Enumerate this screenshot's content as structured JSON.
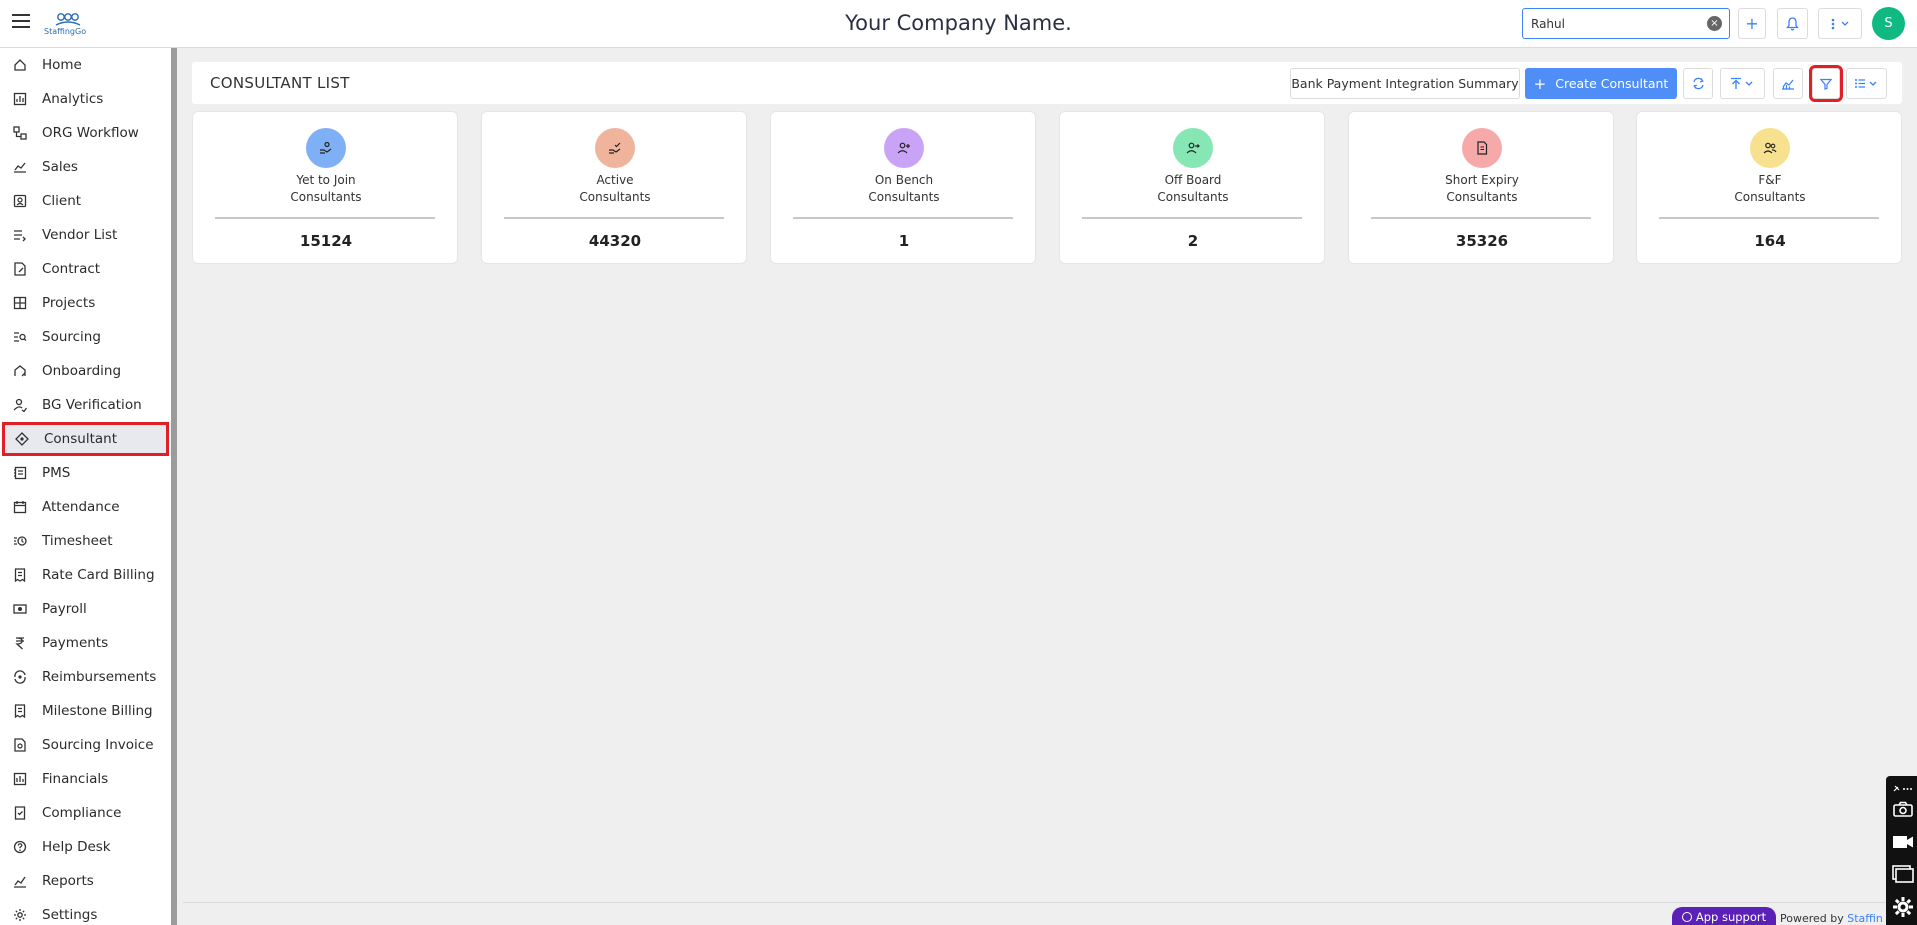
{
  "topbar": {
    "logo_text": "StaffingGo",
    "company_name": "Your Company Name.",
    "search_value": "Rahul",
    "clear_symbol": "×",
    "add_symbol": "+",
    "avatar_initial": "S"
  },
  "sidebar": {
    "items": [
      {
        "label": "Home",
        "icon": "home-icon"
      },
      {
        "label": "Analytics",
        "icon": "analytics-icon"
      },
      {
        "label": "ORG Workflow",
        "icon": "workflow-icon"
      },
      {
        "label": "Sales",
        "icon": "sales-icon"
      },
      {
        "label": "Client",
        "icon": "client-icon"
      },
      {
        "label": "Vendor List",
        "icon": "vendor-icon"
      },
      {
        "label": "Contract",
        "icon": "contract-icon"
      },
      {
        "label": "Projects",
        "icon": "projects-icon"
      },
      {
        "label": "Sourcing",
        "icon": "sourcing-icon"
      },
      {
        "label": "Onboarding",
        "icon": "onboarding-icon"
      },
      {
        "label": "BG Verification",
        "icon": "verification-icon"
      },
      {
        "label": "Consultant",
        "icon": "consultant-icon",
        "active": true
      },
      {
        "label": "PMS",
        "icon": "pms-icon"
      },
      {
        "label": "Attendance",
        "icon": "calendar-icon"
      },
      {
        "label": "Timesheet",
        "icon": "timesheet-icon"
      },
      {
        "label": "Rate Card Billing",
        "icon": "billing-icon"
      },
      {
        "label": "Payroll",
        "icon": "payroll-icon"
      },
      {
        "label": "Payments",
        "icon": "rupee-icon"
      },
      {
        "label": "Reimbursements",
        "icon": "reimbursement-icon"
      },
      {
        "label": "Milestone Billing",
        "icon": "milestone-icon"
      },
      {
        "label": "Sourcing Invoice",
        "icon": "invoice-icon"
      },
      {
        "label": "Financials",
        "icon": "financials-icon"
      },
      {
        "label": "Compliance",
        "icon": "compliance-icon"
      },
      {
        "label": "Help Desk",
        "icon": "help-icon"
      },
      {
        "label": "Reports",
        "icon": "reports-icon"
      },
      {
        "label": "Settings",
        "icon": "settings-icon"
      }
    ]
  },
  "header": {
    "title": "CONSULTANT LIST",
    "bank_summary_label": "Bank Payment Integration Summary",
    "create_label": "Create Consultant",
    "create_symbol": "+"
  },
  "cards": [
    {
      "line1": "Yet to Join",
      "line2": "Consultants",
      "count": "15124",
      "color": "#7fb0f5",
      "icon": "user-hand-icon"
    },
    {
      "line1": "Active",
      "line2": "Consultants",
      "count": "44320",
      "color": "#f0b49c",
      "icon": "user-check-icon"
    },
    {
      "line1": "On Bench",
      "line2": "Consultants",
      "count": "1",
      "color": "#c9a3f5",
      "icon": "user-plus-icon"
    },
    {
      "line1": "Off Board",
      "line2": "Consultants",
      "count": "2",
      "color": "#86e6b4",
      "icon": "user-out-icon"
    },
    {
      "line1": "Short Expiry",
      "line2": "Consultants",
      "count": "35326",
      "color": "#f7a9a9",
      "icon": "document-icon"
    },
    {
      "line1": "F&F",
      "line2": "Consultants",
      "count": "164",
      "color": "#f7e08e",
      "icon": "users-icon"
    }
  ],
  "footer": {
    "app_support": "App support",
    "powered_by": "Powered by",
    "powered_link": "Staffin"
  },
  "colors": {
    "accent": "#3b82f6",
    "primary_button": "#4f8ef7",
    "highlight": "#e01f26",
    "avatar": "#10b981",
    "support": "#5b21b6"
  }
}
